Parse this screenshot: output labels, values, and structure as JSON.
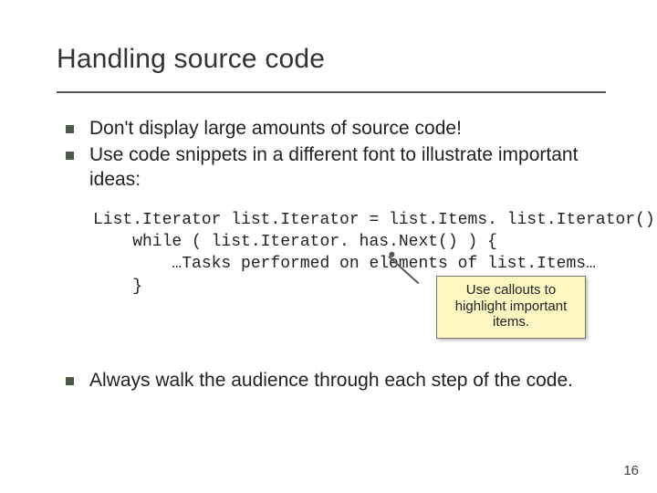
{
  "slide": {
    "title": "Handling source code",
    "bullets_top": [
      "Don't display large amounts of source code!",
      "Use code snippets in a different font to illustrate important ideas:"
    ],
    "code": {
      "l1": "List.Iterator list.Iterator = list.Items. list.Iterator();",
      "l2": "    while ( list.Iterator. has.Next() ) {",
      "l3": "        …Tasks performed on elements of list.Items…",
      "l4": "    }"
    },
    "callout": "Use callouts to highlight important items.",
    "bullets_bottom": [
      "Always walk the audience through each step of the code."
    ],
    "page_number": "16"
  }
}
